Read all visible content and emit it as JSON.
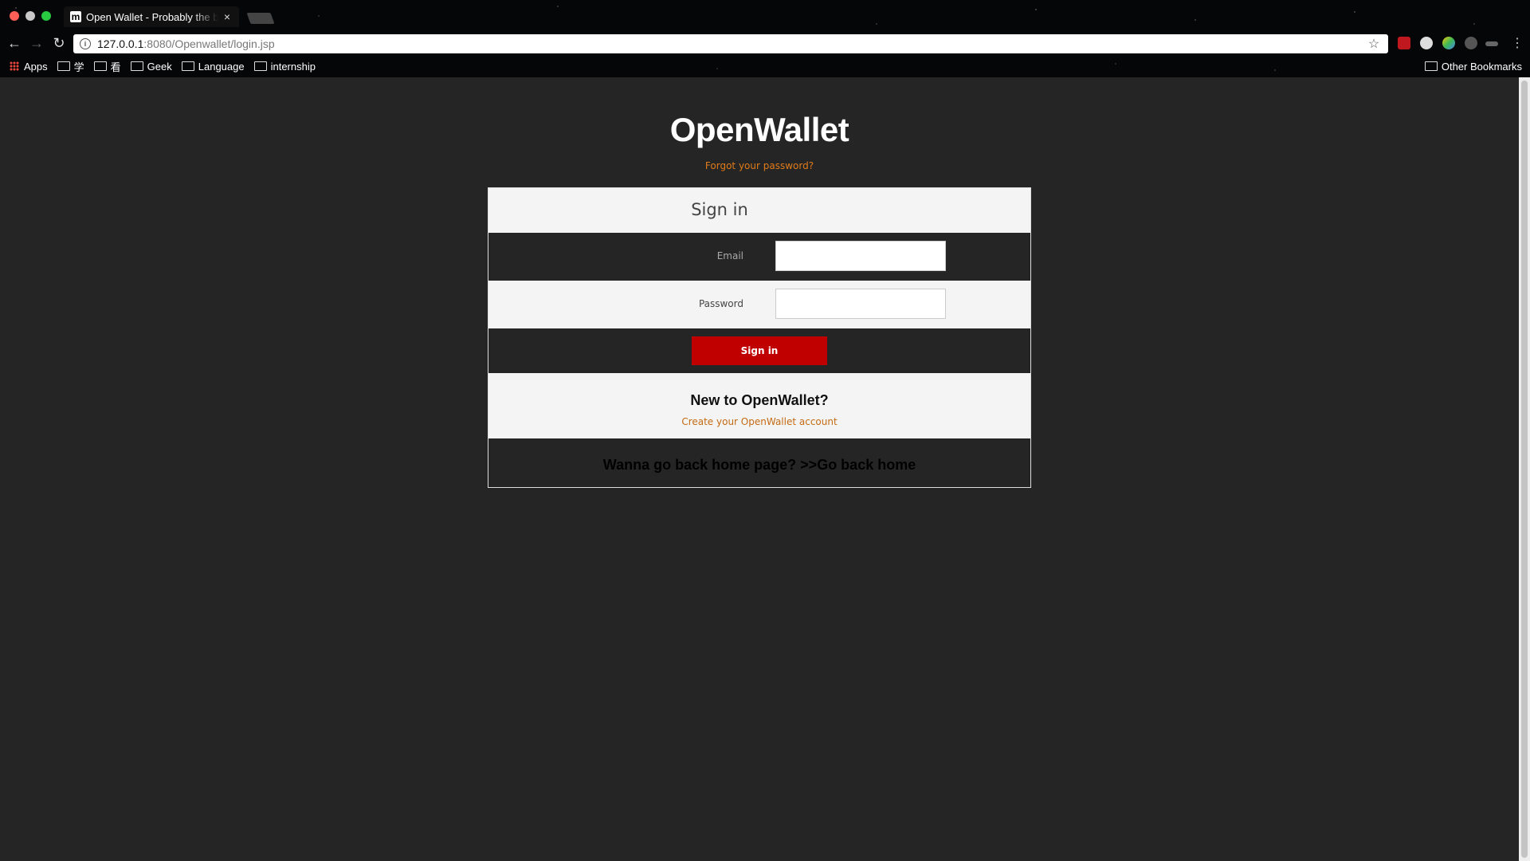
{
  "browser": {
    "tab_title": "Open Wallet - Probably the be",
    "tab_favicon_letter": "m",
    "tab_close": "×",
    "url_host": "127.0.0.1",
    "url_rest": ":8080/Openwallet/login.jsp",
    "nav_back": "←",
    "nav_forward": "→",
    "nav_reload": "↻",
    "star": "☆",
    "menu": "⋮",
    "info": "i",
    "bookmarks": [
      {
        "label": "Apps",
        "icon": "apps-grid-icon"
      },
      {
        "label": "学",
        "icon": "folder-icon"
      },
      {
        "label": "看",
        "icon": "folder-icon"
      },
      {
        "label": "Geek",
        "icon": "folder-icon"
      },
      {
        "label": "Language",
        "icon": "folder-icon"
      },
      {
        "label": "internship",
        "icon": "folder-icon"
      }
    ],
    "other_bookmarks": "Other Bookmarks"
  },
  "page": {
    "logo": "OpenWallet",
    "forgot_password": "Forgot your password?",
    "signin_heading": "Sign in",
    "email_label": "Email",
    "email_value": "",
    "password_label": "Password",
    "password_value": "",
    "signin_button": "Sign in",
    "new_heading": "New to OpenWallet?",
    "create_account": "Create your OpenWallet account",
    "home_prefix": "Wanna go back home page? >>",
    "home_link": "Go back home"
  },
  "colors": {
    "page_bg": "#252525",
    "accent_button": "#c00000",
    "link_orange": "#e07b1a"
  }
}
